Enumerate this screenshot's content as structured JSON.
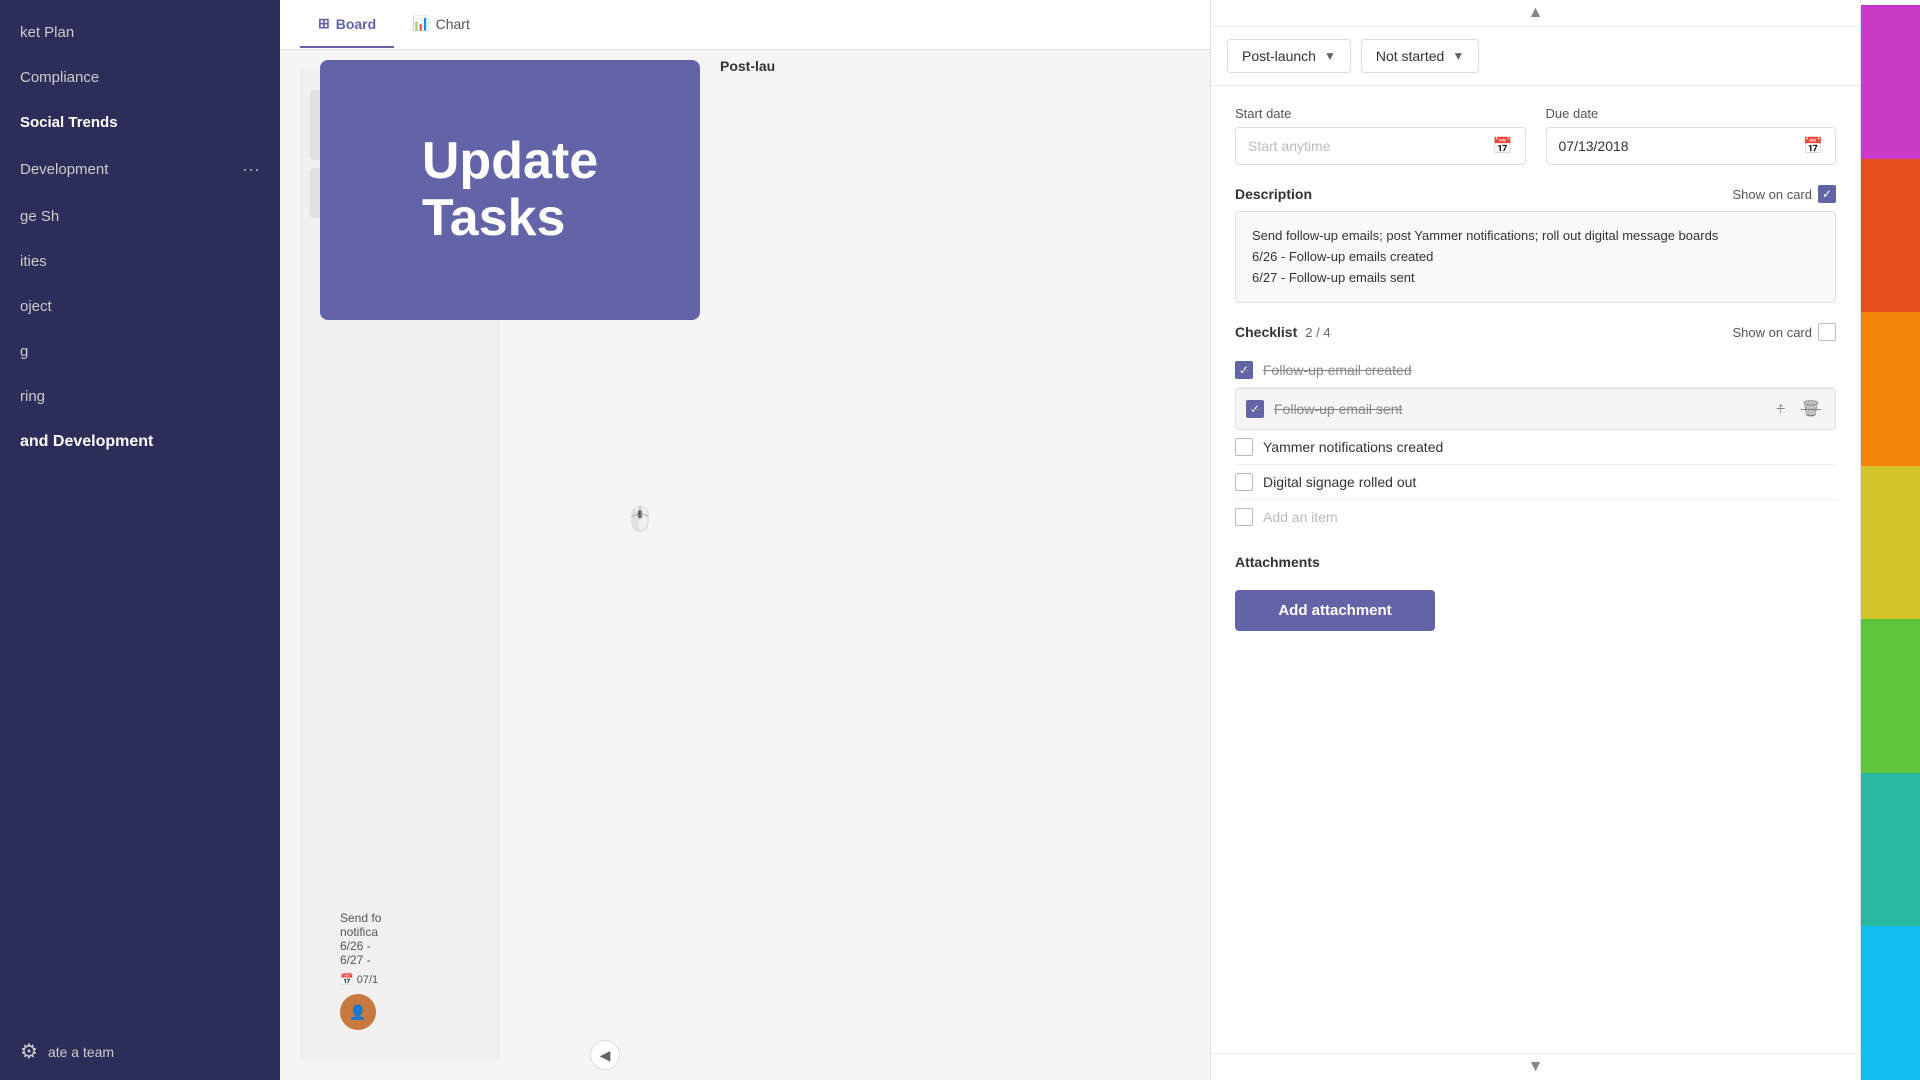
{
  "sidebar": {
    "items": [
      {
        "label": "ket Plan",
        "active": false
      },
      {
        "label": "Compliance",
        "active": false
      },
      {
        "label": "Social Trends",
        "active": true
      },
      {
        "label": "Development",
        "active": false,
        "dots": "···"
      },
      {
        "label": "ge Sh",
        "active": false
      },
      {
        "label": "ities",
        "active": false
      },
      {
        "label": "oject",
        "active": false
      },
      {
        "label": "g",
        "active": false
      },
      {
        "label": "ring",
        "active": false
      },
      {
        "label": "and Development",
        "active": false,
        "bold": true
      },
      {
        "label": "ate a team",
        "active": false
      }
    ],
    "footer": {
      "label": "ate a team",
      "gear_icon": "⚙"
    }
  },
  "board": {
    "tabs": [
      {
        "label": "Board",
        "icon": "⊞",
        "active": true
      },
      {
        "label": "Chart",
        "icon": "📊",
        "active": false
      }
    ],
    "column_label": "Post-lau"
  },
  "overlay_card": {
    "title": "Update\nTasks"
  },
  "task_detail": {
    "header": {
      "phase_dropdown": "Post-launch",
      "status_dropdown": "Not started",
      "close_icon": "×"
    },
    "start_date": {
      "label": "Start date",
      "placeholder": "Start anytime",
      "calendar_icon": "📅"
    },
    "due_date": {
      "label": "Due date",
      "value": "07/13/2018",
      "calendar_icon": "📅"
    },
    "description": {
      "label": "Description",
      "show_on_card": "Show on card",
      "checked": true,
      "text": "Send follow-up emails; post Yammer notifications; roll out digital message boards\n6/26 - Follow-up emails created\n6/27 - Follow-up emails sent"
    },
    "checklist": {
      "label": "Checklist",
      "progress": "2 / 4",
      "show_on_card": "Show on card",
      "checked": false,
      "items": [
        {
          "label": "Follow-up email created",
          "checked": true,
          "active": false
        },
        {
          "label": "Follow-up email sent",
          "checked": true,
          "active": true
        },
        {
          "label": "Yammer notifications created",
          "checked": false,
          "active": false
        },
        {
          "label": "Digital signage rolled out",
          "checked": false,
          "active": false
        }
      ],
      "add_item_placeholder": "Add an item"
    },
    "attachments": {
      "label": "Attachments",
      "add_button": "Add attachment"
    }
  },
  "color_palette": {
    "colors": [
      "#c839c5",
      "#e94f1e",
      "#f4850a",
      "#d4c42a",
      "#5dc63b",
      "#2ab8a0",
      "#13bef0"
    ]
  },
  "scroll_indicator": {
    "up": "▲",
    "down": "▼"
  }
}
